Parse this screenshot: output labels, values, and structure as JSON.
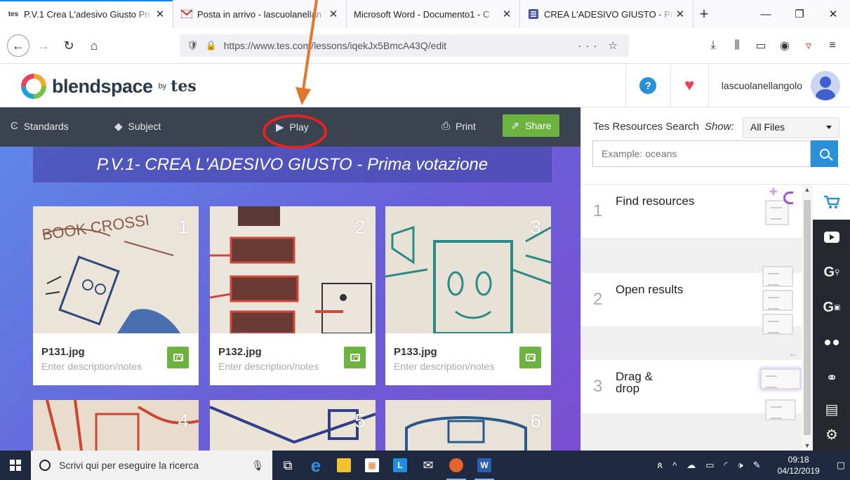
{
  "browser": {
    "tabs": [
      {
        "label": "P.V.1 Crea L'adesivo Giusto Pri",
        "favicon": "tes",
        "active": true
      },
      {
        "label": "Posta in arrivo - lascuolanellan",
        "favicon": "gmail-icon",
        "active": false
      },
      {
        "label": "Microsoft Word - Documento1 - C",
        "favicon": "",
        "active": false
      },
      {
        "label": "CREA L'ADESIVO GIUSTO - Pri",
        "favicon": "list-icon",
        "active": false
      }
    ],
    "url": "https://www.tes.com/lessons/iqekJx5BmcA43Q/edit",
    "url_host": "tes.com"
  },
  "header": {
    "logo_text": "blendspace",
    "logo_by": "by",
    "logo_tes": "tes",
    "username": "lascuolanellangolo",
    "help_label": "?"
  },
  "toolbar": {
    "standards_label": "Standards",
    "subject_label": "Subject",
    "play_label": "Play",
    "print_label": "Print",
    "share_label": "Share"
  },
  "lesson": {
    "title": "P.V.1- CREA L'ADESIVO GIUSTO - Prima votazione",
    "cards": [
      {
        "number": "1",
        "filename": "P131.jpg",
        "placeholder": "Enter description/notes"
      },
      {
        "number": "2",
        "filename": "P132.jpg",
        "placeholder": "Enter description/notes"
      },
      {
        "number": "3",
        "filename": "P133.jpg",
        "placeholder": "Enter description/notes"
      },
      {
        "number": "4",
        "filename": "",
        "placeholder": ""
      },
      {
        "number": "5",
        "filename": "",
        "placeholder": ""
      },
      {
        "number": "6",
        "filename": "",
        "placeholder": ""
      }
    ]
  },
  "resources": {
    "title": "Tes Resources Search",
    "show_label": "Show:",
    "show_value": "All Files",
    "search_placeholder": "Example: oceans",
    "steps": [
      {
        "number": "1",
        "text": "Find resources"
      },
      {
        "number": "2",
        "text": "Open results"
      },
      {
        "number": "3",
        "text": "Drag & drop"
      }
    ],
    "rail_icons": [
      "cart-icon",
      "youtube-icon",
      "google-search-icon",
      "google-image-icon",
      "flickr-icon",
      "link-icon",
      "print-stack-icon",
      "settings-icon"
    ]
  },
  "taskbar": {
    "search_placeholder": "Scrivi qui per eseguire la ricerca",
    "time": "09:18",
    "date": "04/12/2019"
  },
  "colors": {
    "accent_green": "#6cb33f",
    "accent_blue": "#2a90d8",
    "annotation_red": "#e32420",
    "annotation_orange": "#e0772a"
  }
}
